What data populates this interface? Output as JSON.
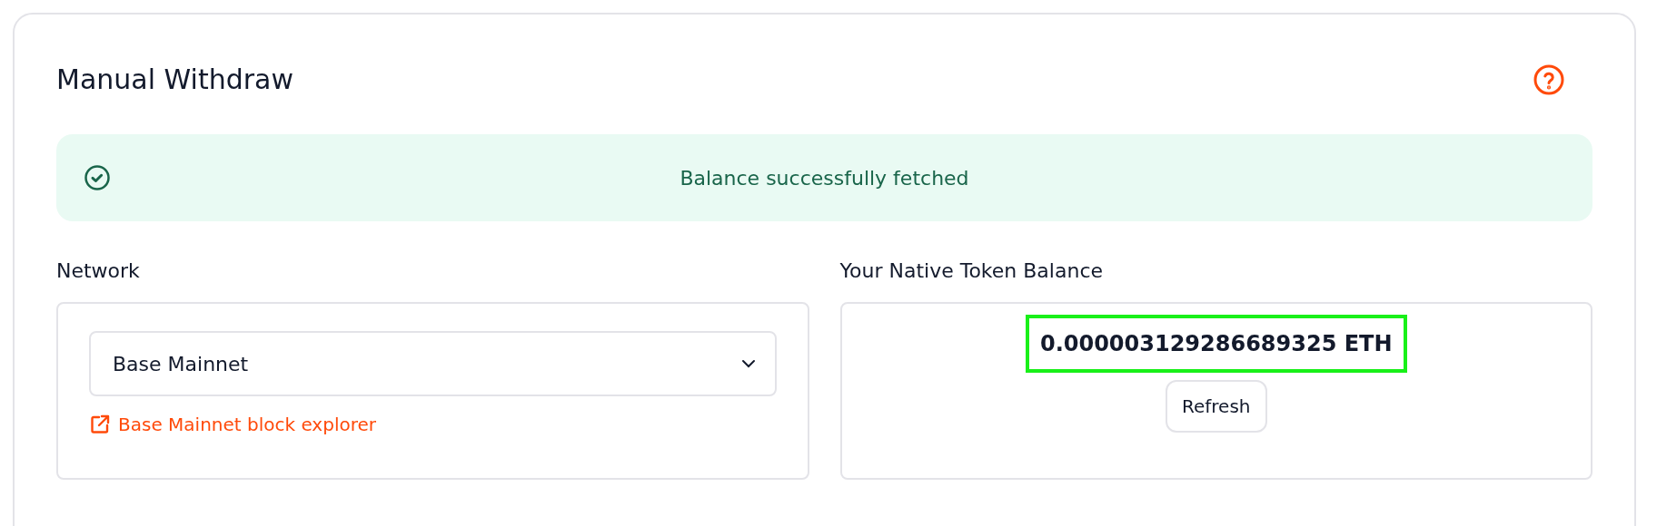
{
  "card": {
    "title": "Manual Withdraw"
  },
  "alert": {
    "kind": "success",
    "message": "Balance successfully fetched"
  },
  "network": {
    "label": "Network",
    "value": "Base Mainnet",
    "explorer_link": "Base Mainnet block explorer"
  },
  "balance": {
    "label": "Your Native Token Balance",
    "value": "0.000003129286689325 ETH",
    "highlighted": true,
    "button": "Refresh"
  }
}
